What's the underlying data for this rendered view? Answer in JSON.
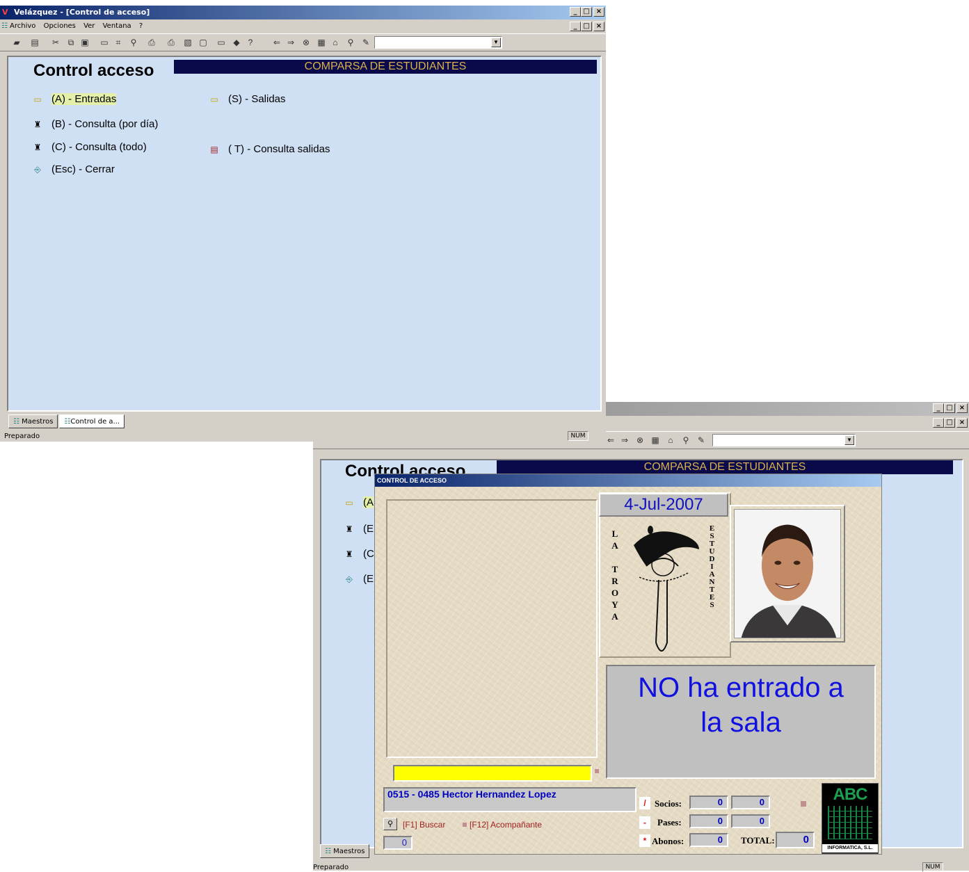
{
  "window1": {
    "title": "Velázquez - [Control de acceso]",
    "menu": [
      "Archivo",
      "Opciones",
      "Ver",
      "Ventana",
      "?"
    ],
    "screen_title": "Control acceso",
    "band": "COMPARSA DE ESTUDIANTES",
    "items": [
      {
        "label": "(A) - Entradas",
        "icon": "folder-open-icon"
      },
      {
        "label": "(B) - Consulta (por día)",
        "icon": "binoculars-icon"
      },
      {
        "label": "(C) - Consulta (todo)",
        "icon": "binoculars-icon"
      },
      {
        "label": "(Esc) - Cerrar",
        "icon": "exit-door-icon"
      },
      {
        "label": "(S) - Salidas",
        "icon": "folder-open-icon"
      },
      {
        "label": "( T) - Consulta salidas",
        "icon": "report-icon"
      }
    ],
    "tabs": [
      "Maestros",
      "Control de a..."
    ],
    "status": "Preparado",
    "num": "NUM"
  },
  "window2": {
    "screen_title": "Control acceso",
    "band": "COMPARSA DE ESTUDIANTES",
    "items_partial": [
      "(A",
      "(E",
      "(C",
      "(E"
    ],
    "tabs": [
      "Maestros"
    ],
    "status": "Preparado",
    "num": "NUM"
  },
  "dialog": {
    "title": "CONTROL DE ACCESO",
    "date": "4-Jul-2007",
    "left_vertical": "LA TROYA",
    "right_vertical": "ESTUDIANTES",
    "message_line1": "NO ha entrado a",
    "message_line2": "la sala",
    "member": "0515 - 0485   Hector Hernandez Lopez",
    "search": "[F1] Buscar",
    "companion": "[F12] Acompañante",
    "counter": "0",
    "socios_label": "Socios:",
    "pases_label": "Pases:",
    "abonos_label": "Abonos:",
    "total_label": "TOTAL:",
    "socios": [
      "0",
      "0"
    ],
    "pases": [
      "0",
      "0"
    ],
    "abonos": "0",
    "total": "0",
    "sym_socios": "/",
    "sym_pases": "-",
    "sym_abonos": "*",
    "logo_top": "ABC",
    "logo_bottom": "INFORMATICA, S.L."
  }
}
